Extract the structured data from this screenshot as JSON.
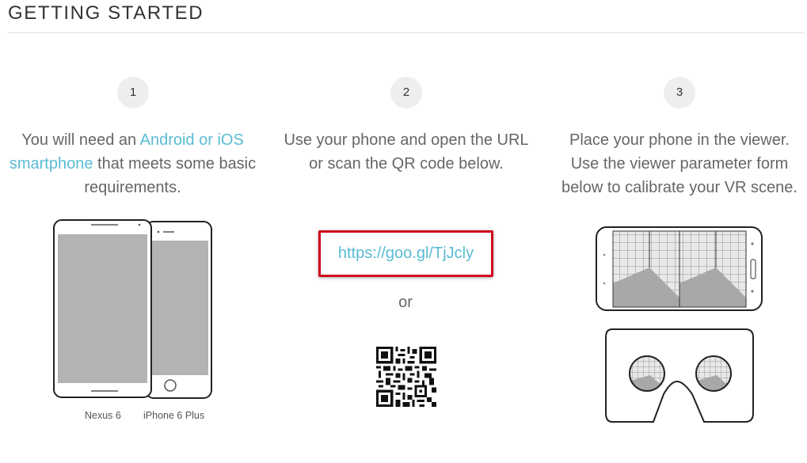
{
  "header": {
    "title": "GETTING STARTED"
  },
  "steps": [
    {
      "number": "1",
      "text_before": "You will need an ",
      "link_text": "Android or iOS smartphone",
      "text_after": " that meets some basic requirements.",
      "devices": [
        "Nexus 6",
        "iPhone 6 Plus"
      ]
    },
    {
      "number": "2",
      "text": "Use your phone and open the URL or scan the QR code below.",
      "url": "https://goo.gl/TjJcly",
      "or_label": "or",
      "qr_icon": "qr-code-icon"
    },
    {
      "number": "3",
      "text": "Place your phone in the viewer. Use the viewer parameter form below to calibrate your VR scene."
    }
  ],
  "colors": {
    "link": "#5bbbd4",
    "highlight_border": "#d0021b",
    "step_circle": "#eeeeee"
  }
}
